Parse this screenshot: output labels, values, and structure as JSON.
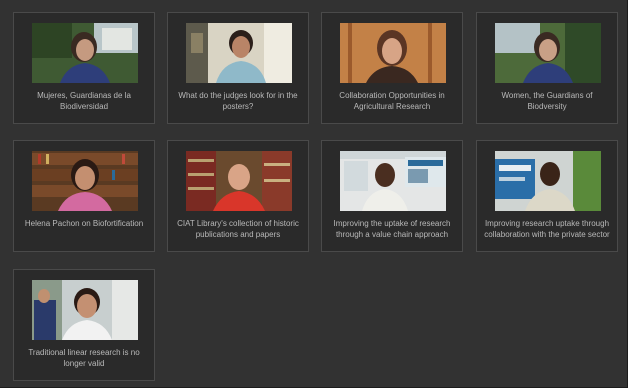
{
  "gallery": {
    "videos": [
      {
        "caption": "Mujeres, Guardianas de la Biodiversidad"
      },
      {
        "caption": "What do the judges look for in the posters?"
      },
      {
        "caption": "Collaboration Opportunities in Agricultural Research"
      },
      {
        "caption": "Women, the Guardians of Biodversity"
      },
      {
        "caption": "Helena Pachon on Biofortification"
      },
      {
        "caption": "CIAT Library's collection of historic publications and papers"
      },
      {
        "caption": "Improving the uptake of research through a value chain approach"
      },
      {
        "caption": "Improving research uptake through collaboration with the private sector"
      },
      {
        "caption": "Traditional linear research is no longer valid"
      }
    ]
  }
}
